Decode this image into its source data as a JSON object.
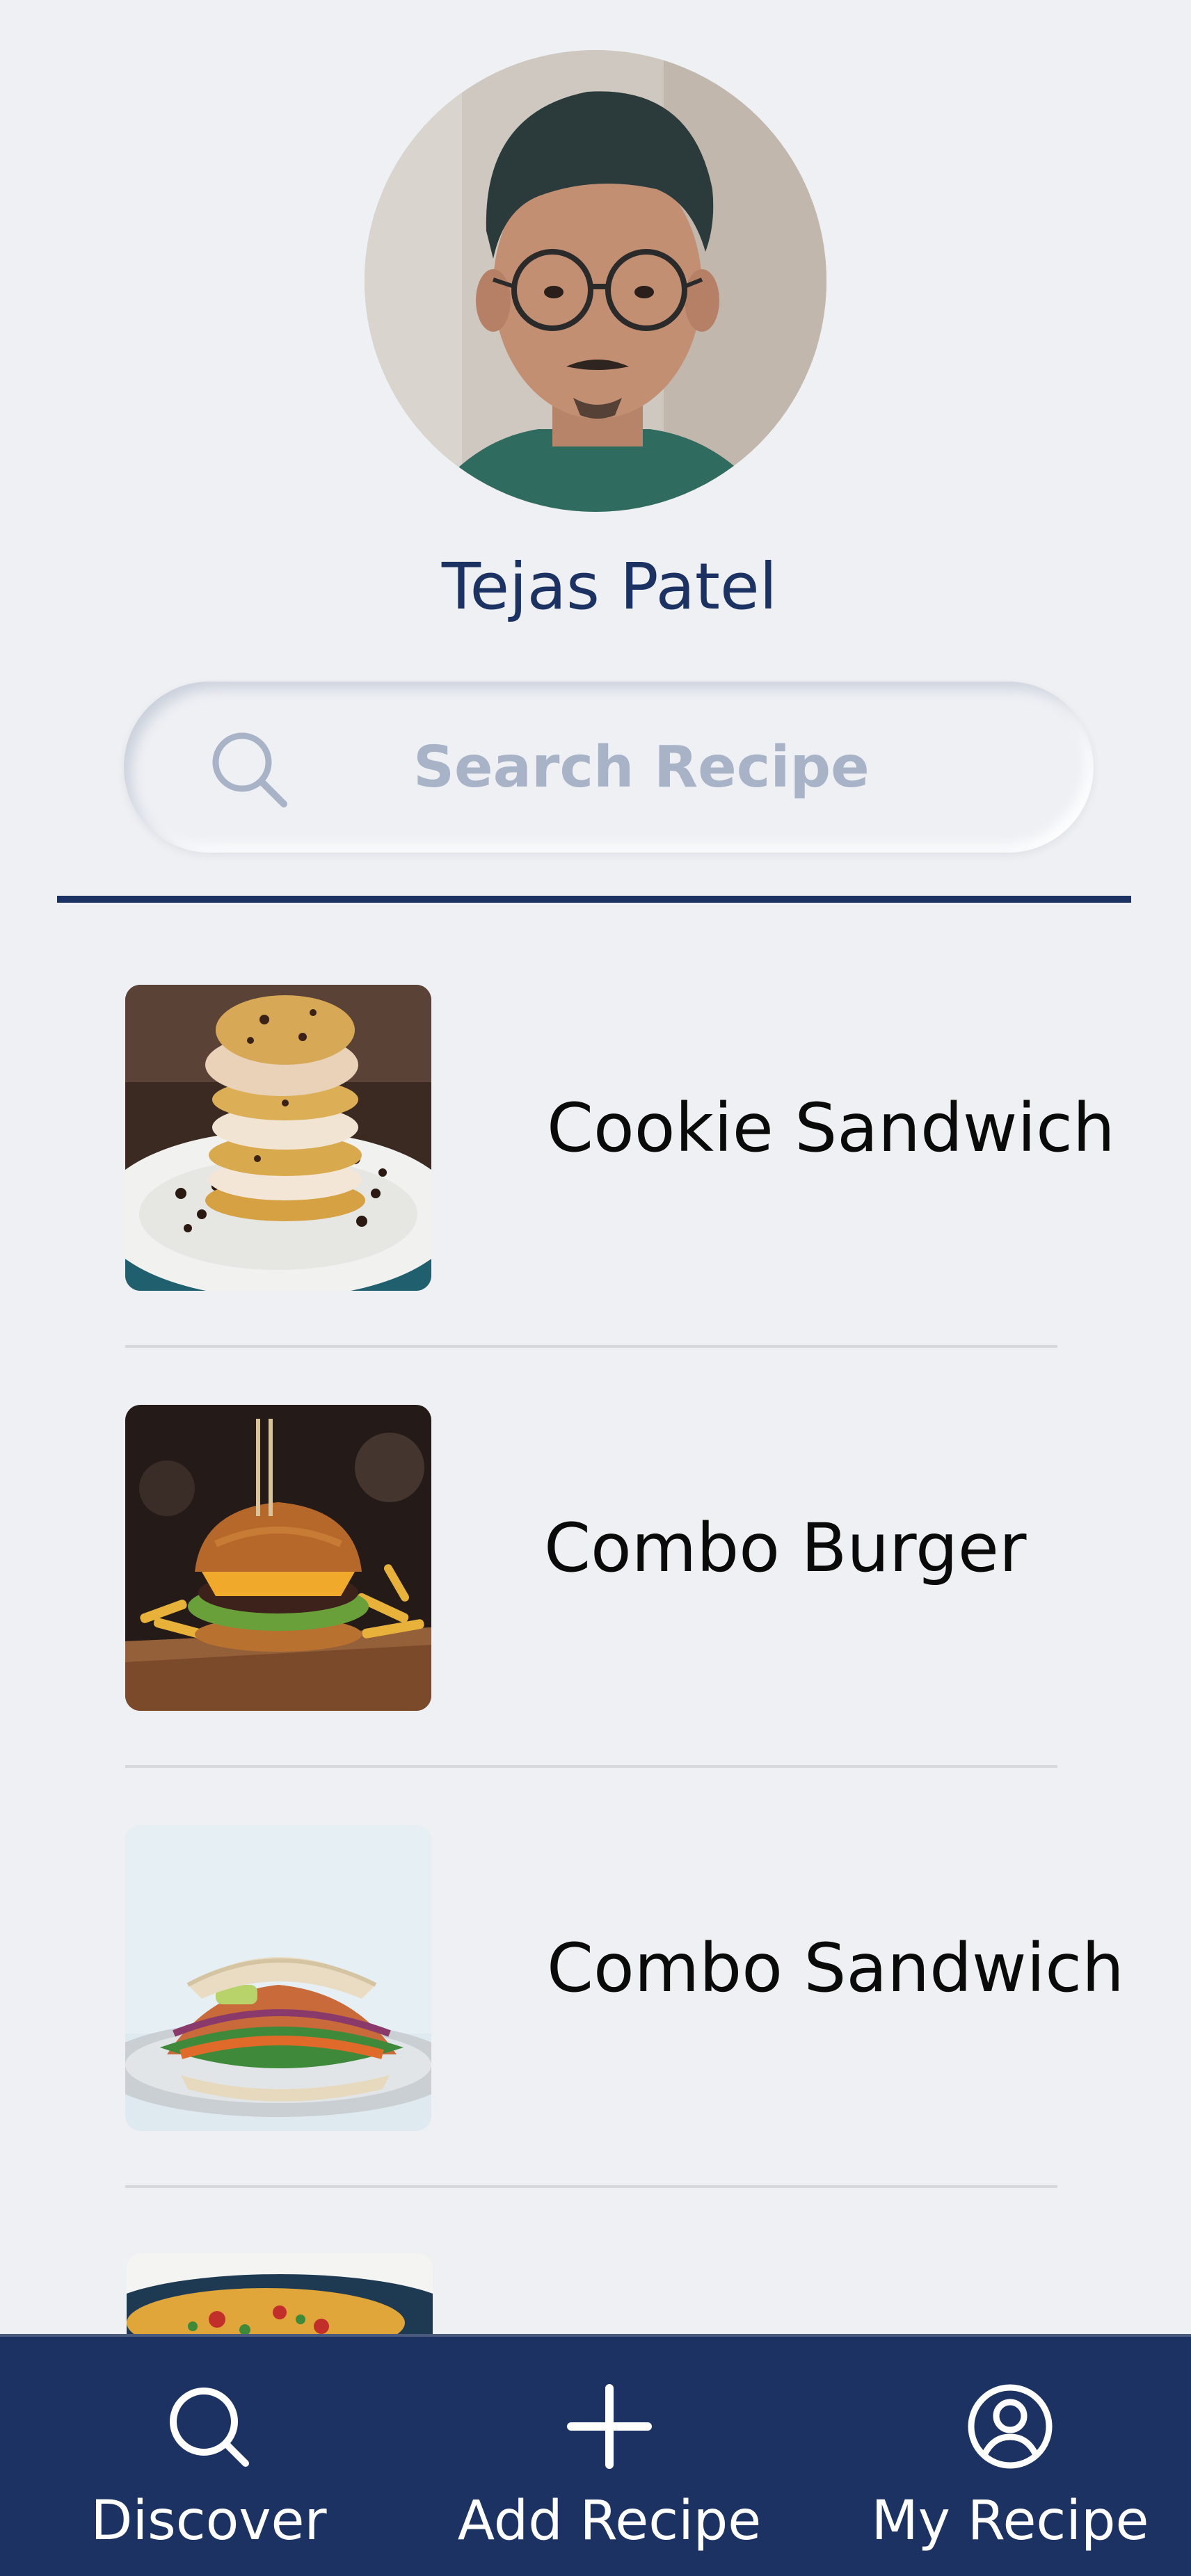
{
  "profile": {
    "name": "Tejas Patel"
  },
  "search": {
    "placeholder": "Search Recipe",
    "icon": "search-icon"
  },
  "recipes": [
    {
      "title": "Cookie Sandwich",
      "image": "cookie-sandwich-photo"
    },
    {
      "title": "Combo Burger",
      "image": "combo-burger-photo"
    },
    {
      "title": "Combo Sandwich",
      "image": "combo-sandwich-photo"
    },
    {
      "title": "",
      "image": "pasta-bowl-photo"
    }
  ],
  "bottom_nav": {
    "items": [
      {
        "label": "Discover",
        "icon": "search-icon"
      },
      {
        "label": "Add Recipe",
        "icon": "plus-icon"
      },
      {
        "label": "My Recipe",
        "icon": "user-circle-icon"
      }
    ]
  },
  "colors": {
    "primary": "#1c3262",
    "background": "#eef0f3",
    "placeholder": "#a9b3c7",
    "separator": "#d4d7dc"
  }
}
